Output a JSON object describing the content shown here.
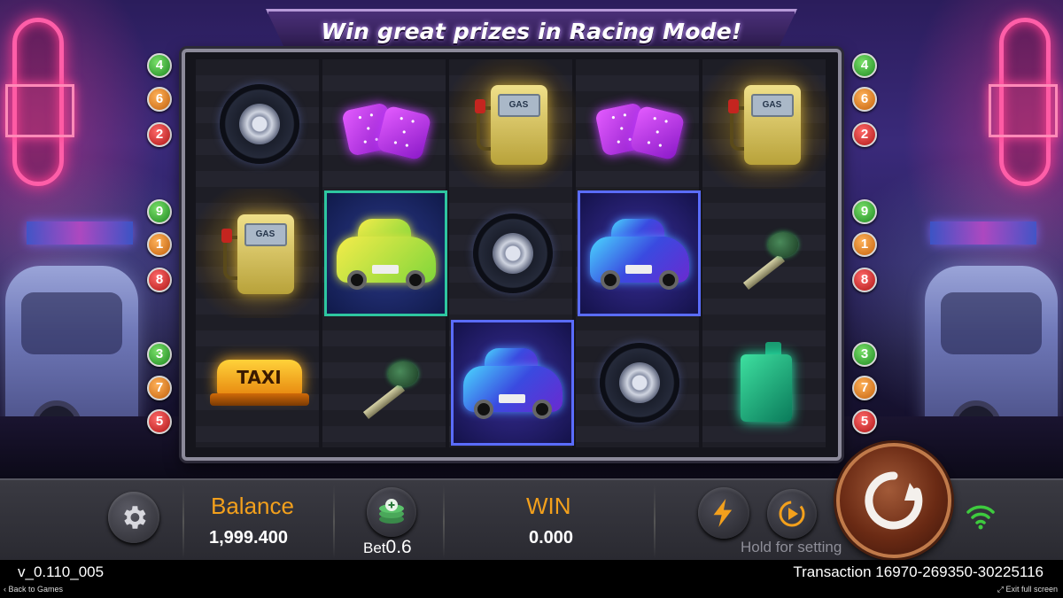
{
  "banner": {
    "title": "Win great prizes in Racing Mode!"
  },
  "paylines": {
    "left": [
      {
        "num": "4",
        "color": "green"
      },
      {
        "num": "6",
        "color": "orange"
      },
      {
        "num": "2",
        "color": "red"
      },
      {
        "num": "9",
        "color": "green"
      },
      {
        "num": "1",
        "color": "orange"
      },
      {
        "num": "8",
        "color": "red"
      },
      {
        "num": "3",
        "color": "green"
      },
      {
        "num": "7",
        "color": "orange"
      },
      {
        "num": "5",
        "color": "red"
      }
    ],
    "right": [
      {
        "num": "4",
        "color": "green"
      },
      {
        "num": "6",
        "color": "orange"
      },
      {
        "num": "2",
        "color": "red"
      },
      {
        "num": "9",
        "color": "green"
      },
      {
        "num": "1",
        "color": "orange"
      },
      {
        "num": "8",
        "color": "red"
      },
      {
        "num": "3",
        "color": "green"
      },
      {
        "num": "7",
        "color": "orange"
      },
      {
        "num": "5",
        "color": "red"
      }
    ]
  },
  "reels": {
    "rows": [
      [
        "tire-icon",
        "dice-icon",
        "gas-pump-icon",
        "dice-icon",
        "gas-pump-icon"
      ],
      [
        "gas-pump-icon",
        "yellow-taxi-car-icon",
        "tire-icon",
        "blue-taxi-car-icon",
        "key-icon"
      ],
      [
        "taxi-sign-icon",
        "key-icon",
        "blue-taxi-car-icon",
        "tire-icon",
        "jerry-can-icon"
      ]
    ],
    "gas_label": "GAS",
    "taxi_label": "TAXI"
  },
  "controls": {
    "balance_label": "Balance",
    "balance_value": "1,999.400",
    "bet_label": "Bet",
    "bet_value": "0.6",
    "win_label": "WIN",
    "win_value": "0.000",
    "hold_hint": "Hold for setting"
  },
  "footer": {
    "version": "v_0.110_005",
    "transaction": "Transaction 16970-269350-30225116",
    "back_link": "Back to Games",
    "exit_link": "Exit full screen"
  },
  "colors": {
    "accent_orange": "#f3a01c",
    "payline_green": "#1f8a22",
    "payline_orange": "#c4620c",
    "payline_red": "#b01616",
    "connection_green": "#3ecb3e"
  }
}
